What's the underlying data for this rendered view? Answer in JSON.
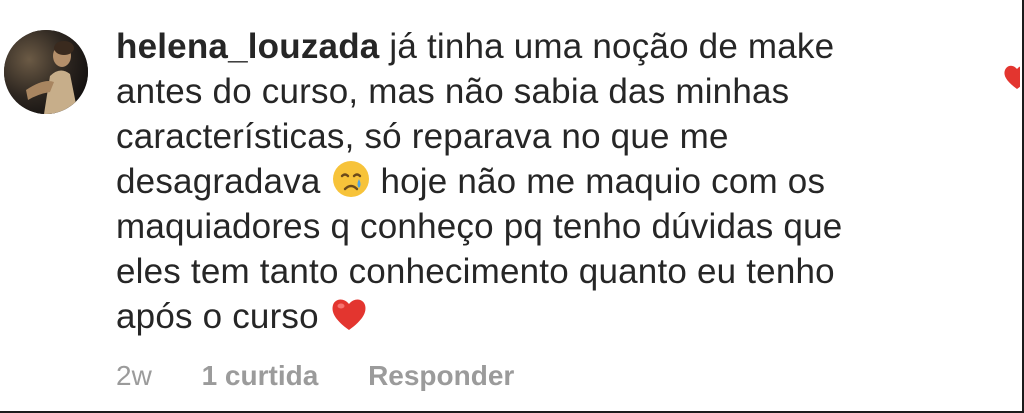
{
  "comment": {
    "username": "helena_louzada",
    "lines": [
      "já tinha uma noção de make",
      "antes do curso, mas não sabia das minhas",
      "características, só reparava no que me",
      "desagradava",
      "hoje não me maquio com os",
      "maquiadores q conheço pq tenho dúvidas que",
      "eles tem tanto conhecimento quanto eu tenho",
      "após o curso"
    ],
    "emoji_sad": "crying-face-emoji",
    "emoji_heart": "red-heart-emoji"
  },
  "meta": {
    "time": "2w",
    "likes": "1 curtida",
    "reply": "Responder"
  },
  "colors": {
    "text": "#262626",
    "meta_text": "#9b9b9b",
    "heart": "#e3352f"
  }
}
